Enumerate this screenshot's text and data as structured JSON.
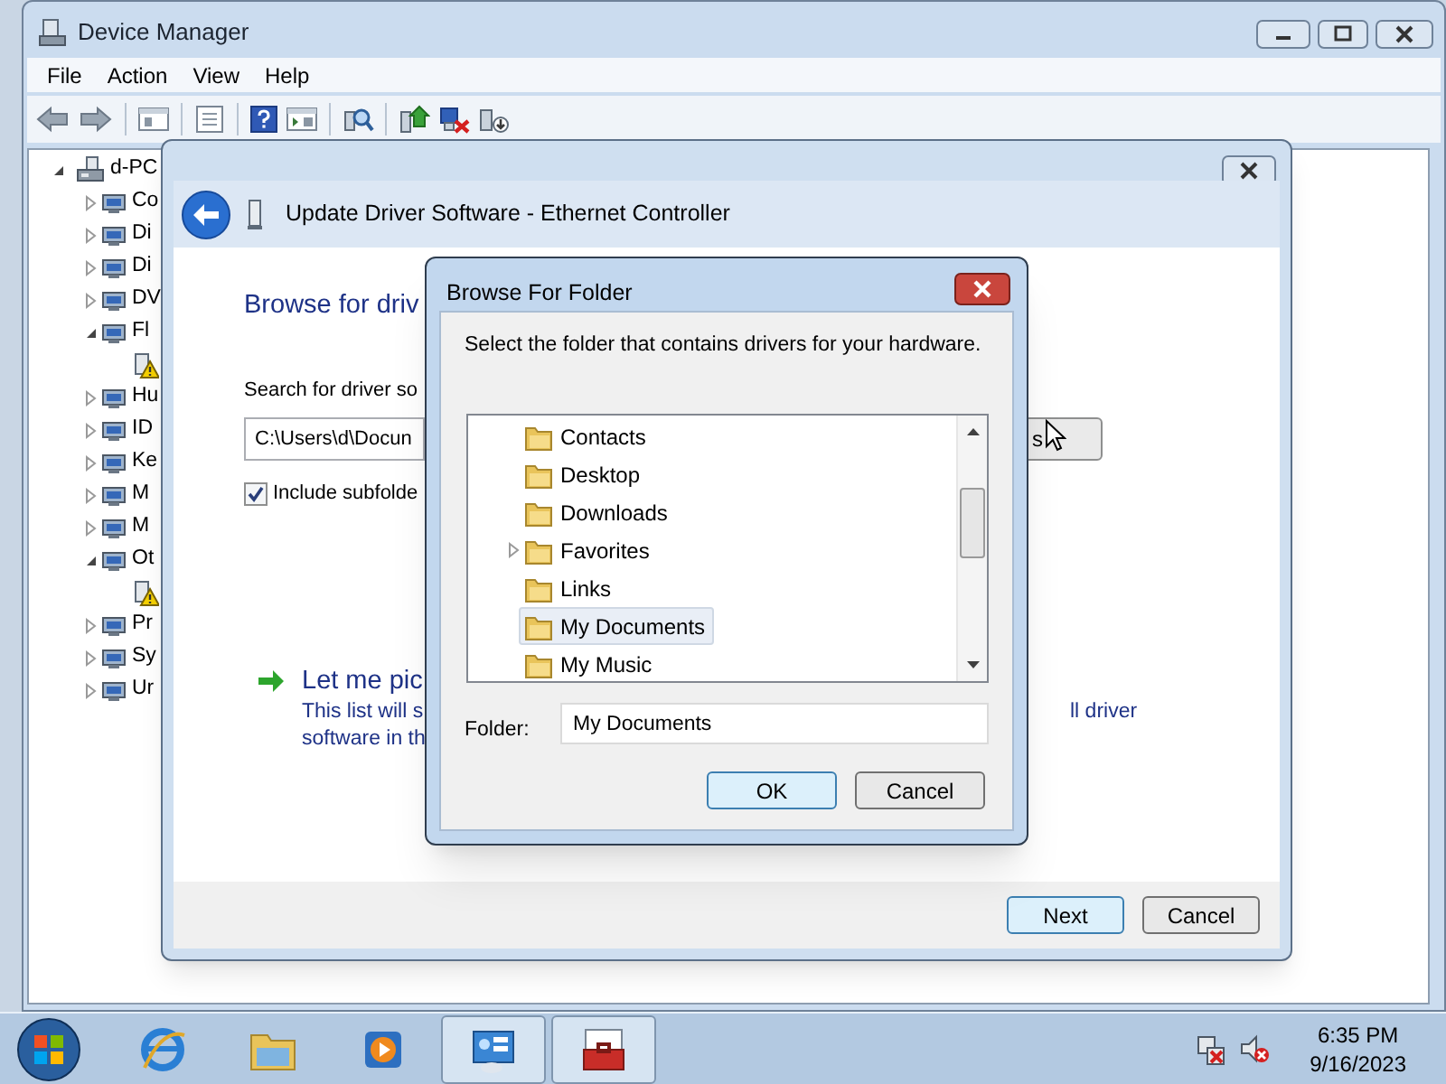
{
  "device_manager": {
    "title": "Device Manager",
    "menu": [
      "File",
      "Action",
      "View",
      "Help"
    ],
    "tree": {
      "label": "d-PC",
      "expanded": true,
      "children": [
        {
          "label": "Co",
          "expanded": false
        },
        {
          "label": "Di",
          "expanded": false
        },
        {
          "label": "Di",
          "expanded": false
        },
        {
          "label": "DV",
          "expanded": false
        },
        {
          "label": "Fl",
          "expanded": true,
          "children": [
            {
              "kind": "warning"
            }
          ]
        },
        {
          "label": "Hu",
          "expanded": false
        },
        {
          "label": "ID",
          "expanded": false
        },
        {
          "label": "Ke",
          "expanded": false
        },
        {
          "label": "M",
          "expanded": false
        },
        {
          "label": "M",
          "expanded": false
        },
        {
          "label": "Ot",
          "expanded": true,
          "children": [
            {
              "kind": "warning"
            }
          ]
        },
        {
          "label": "Pr",
          "expanded": false
        },
        {
          "label": "Sy",
          "expanded": false
        },
        {
          "label": "Ur",
          "expanded": false
        }
      ]
    }
  },
  "update_dialog": {
    "title": "Update Driver Software - Ethernet Controller",
    "heading": "Browse for driv",
    "search_label": "Search for driver so",
    "path_value": "C:\\Users\\d\\Docun",
    "browse_button_fragment": "s",
    "include_subfolders": {
      "label": "Include subfolde",
      "checked": true
    },
    "option_title": "Let me pic",
    "option_lines": [
      "This list will s",
      "software in th"
    ],
    "option_text_right": "ll driver",
    "buttons": [
      {
        "label": "Next",
        "default": true
      },
      {
        "label": "Cancel",
        "default": false
      }
    ]
  },
  "browse_dialog": {
    "title": "Browse For Folder",
    "instruction": "Select the folder that contains drivers for your hardware.",
    "folders": [
      {
        "label": "Contacts",
        "selected": false,
        "has_children": false
      },
      {
        "label": "Desktop",
        "selected": false,
        "has_children": false
      },
      {
        "label": "Downloads",
        "selected": false,
        "has_children": false
      },
      {
        "label": "Favorites",
        "selected": false,
        "has_children": true
      },
      {
        "label": "Links",
        "selected": false,
        "has_children": false
      },
      {
        "label": "My Documents",
        "selected": true,
        "has_children": false
      },
      {
        "label": "My Music",
        "selected": false,
        "has_children": false
      }
    ],
    "folder_label": "Folder:",
    "folder_value": "My Documents",
    "buttons": [
      {
        "label": "OK",
        "default": true
      },
      {
        "label": "Cancel",
        "default": false
      }
    ]
  },
  "taskbar": {
    "apps": [
      {
        "active": false
      },
      {
        "active": false
      },
      {
        "active": false
      },
      {
        "active": true
      },
      {
        "active": true
      }
    ],
    "time": "6:35 PM",
    "date": "9/16/2023"
  }
}
